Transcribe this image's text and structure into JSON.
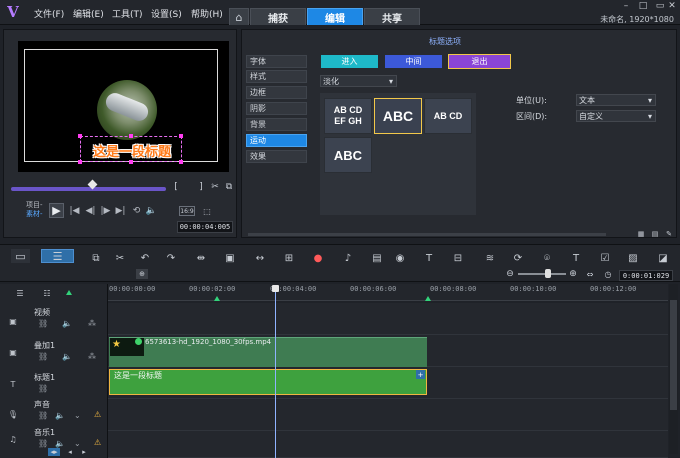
{
  "menu": [
    "文件(F)",
    "编辑(E)",
    "工具(T)",
    "设置(S)",
    "帮助(H)"
  ],
  "tabs": {
    "capture": "捕获",
    "edit": "编辑",
    "share": "共享"
  },
  "document": {
    "name": "未命名, 1920*1080"
  },
  "player": {
    "overlay_title": "这是一段标题",
    "project_label": "项目-",
    "clip_label": "素材-",
    "timecode": "00:00:04:005",
    "ratio": "16:9"
  },
  "options": {
    "heading": "标题选项",
    "side_tabs": [
      "字体",
      "样式",
      "边框",
      "阴影",
      "背景",
      "运动",
      "效果"
    ],
    "active_tab": "运动",
    "phase_buttons": [
      "进入",
      "中间",
      "退出"
    ],
    "effect_select": "淡化",
    "presets": [
      {
        "label": "AB CD\nEF GH",
        "size": "9px"
      },
      {
        "label": "ABC",
        "size": "14px"
      },
      {
        "label": "AB CD",
        "size": "9px"
      },
      {
        "label": "ABC",
        "size": "13px"
      }
    ],
    "unit_label": "单位(U):",
    "unit_value": "文本",
    "area_label": "区间(D):",
    "area_value": "自定义"
  },
  "timeline": {
    "zoom_time": "0:00:01:029",
    "ruler": [
      "00:00:00:00",
      "00:00:02:00",
      "00:00:04:00",
      "00:00:06:00",
      "00:00:08:00",
      "00:00:10:00",
      "00:00:12:00"
    ],
    "tracks": [
      {
        "name": "视频",
        "icon": "video-track-icon"
      },
      {
        "name": "叠加1",
        "icon": "overlay-track-icon"
      },
      {
        "name": "标题1",
        "icon": "title-track-icon"
      },
      {
        "name": "声音",
        "icon": "voice-track-icon"
      },
      {
        "name": "音乐1",
        "icon": "music-track-icon"
      }
    ],
    "video_clip": "6573613-hd_1920_1080_30fps.mp4",
    "title_clip": "这是一段标题"
  },
  "colors": {
    "accent": "#1e88e5",
    "title_clip": "#3ea13e",
    "overlay_clip": "#3f7c52",
    "exit_button": "#8a45d6"
  }
}
